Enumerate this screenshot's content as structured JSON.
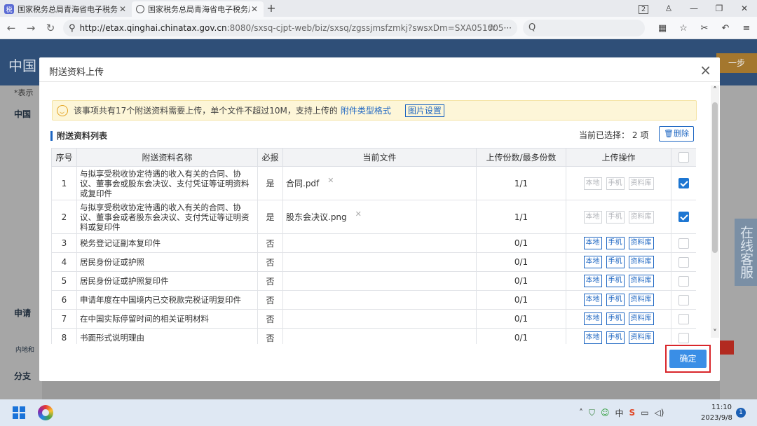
{
  "browser": {
    "tabs": [
      {
        "title": "国家税务总局青海省电子税务局",
        "favicon": "tax-icon",
        "active": false
      },
      {
        "title": "国家税务总局青海省电子税务局",
        "favicon": "globe-icon",
        "active": true
      }
    ],
    "new_tab": "+",
    "tab_count": "2",
    "url_host": "http://etax.qinghai.chinatax.gov.cn",
    "url_path": ":8080/sxsq-cjpt-web/biz/sxsq/zgssjmsfzmkj?swsxDm=SXA051005",
    "search_placeholder": "Q"
  },
  "background_page": {
    "logo_text": "中国",
    "next_button": "一步",
    "side_note": "*表示",
    "section_1": "中国",
    "section_2": "申请",
    "section_3": "分支",
    "row_label": "内地和",
    "chat_label": "在线客服"
  },
  "modal": {
    "title": "附送资料上传",
    "close": "×",
    "notice": {
      "text": "该事项共有17个附送资料需要上传，单个文件不超过10M，支持上传的",
      "link": "附件类型格式",
      "pic_settings": "图片设置"
    },
    "list_title": "附送资料列表",
    "selected_label": "当前已选择：",
    "selected_count": "2",
    "selected_unit": "项",
    "delete_button": "删除",
    "columns": [
      "序号",
      "附送资料名称",
      "必报",
      "当前文件",
      "上传份数/最多份数",
      "上传操作"
    ],
    "op_labels": {
      "local": "本地",
      "phone": "手机",
      "library": "资料库"
    },
    "rows": [
      {
        "no": "1",
        "name": "与拟享受税收协定待遇的收入有关的合同、协议、董事会或股东会决议、支付凭证等证明资料或复印件",
        "required": "是",
        "file": "合同.pdf",
        "count": "1/1",
        "checked": true,
        "enabled": false
      },
      {
        "no": "2",
        "name": "与拟享受税收协定待遇的收入有关的合同、协议、董事会或者股东会决议、支付凭证等证明资料或复印件",
        "required": "是",
        "file": "股东会决议.png",
        "count": "1/1",
        "checked": true,
        "enabled": false
      },
      {
        "no": "3",
        "name": "税务登记证副本复印件",
        "required": "否",
        "file": "",
        "count": "0/1",
        "checked": false,
        "enabled": true
      },
      {
        "no": "4",
        "name": "居民身份证或护照",
        "required": "否",
        "file": "",
        "count": "0/1",
        "checked": false,
        "enabled": true
      },
      {
        "no": "5",
        "name": "居民身份证或护照复印件",
        "required": "否",
        "file": "",
        "count": "0/1",
        "checked": false,
        "enabled": true
      },
      {
        "no": "6",
        "name": "申请年度在中国境内已交税款完税证明复印件",
        "required": "否",
        "file": "",
        "count": "0/1",
        "checked": false,
        "enabled": true
      },
      {
        "no": "7",
        "name": "在中国实际停留时间的相关证明材料",
        "required": "否",
        "file": "",
        "count": "0/1",
        "checked": false,
        "enabled": true
      },
      {
        "no": "8",
        "name": "书面形式说明理由",
        "required": "否",
        "file": "",
        "count": "0/1",
        "checked": false,
        "enabled": true
      }
    ],
    "confirm_button": "确定"
  },
  "taskbar": {
    "time": "11:10",
    "date": "2023/9/8",
    "notification_count": "1",
    "tray_lang": "中"
  },
  "colors": {
    "accent": "#1d66c2",
    "highlight": "#d9262b",
    "notice_bg": "#fdf6d8"
  }
}
